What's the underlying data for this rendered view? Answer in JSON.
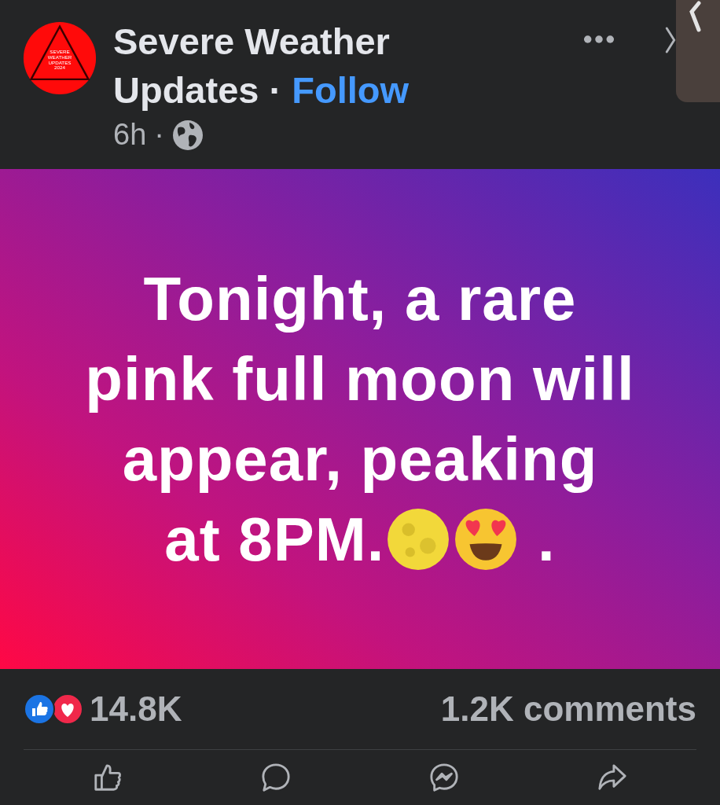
{
  "header": {
    "logo_text": [
      "SEVERE",
      "WEATHER",
      "UPDATES",
      "2024"
    ],
    "page_name": "Severe Weather Updates",
    "separator": "·",
    "follow": "Follow",
    "time": "6h",
    "time_separator": "·"
  },
  "post": {
    "segments": [
      {
        "kind": "text",
        "text": "Tonight, a rare"
      },
      {
        "kind": "break"
      },
      {
        "kind": "text",
        "text": "pink full moon will"
      },
      {
        "kind": "break"
      },
      {
        "kind": "text",
        "text": "appear, peaking"
      },
      {
        "kind": "break"
      },
      {
        "kind": "text",
        "text": "at 8PM."
      },
      {
        "kind": "moon"
      },
      {
        "kind": "heart_eyes"
      },
      {
        "kind": "text",
        "text": " ."
      }
    ]
  },
  "footer": {
    "reactions": "14.8K",
    "comments": "1.2K comments",
    "actions": [
      {
        "kind": "like"
      },
      {
        "kind": "comment"
      },
      {
        "kind": "send"
      },
      {
        "kind": "share"
      }
    ]
  }
}
